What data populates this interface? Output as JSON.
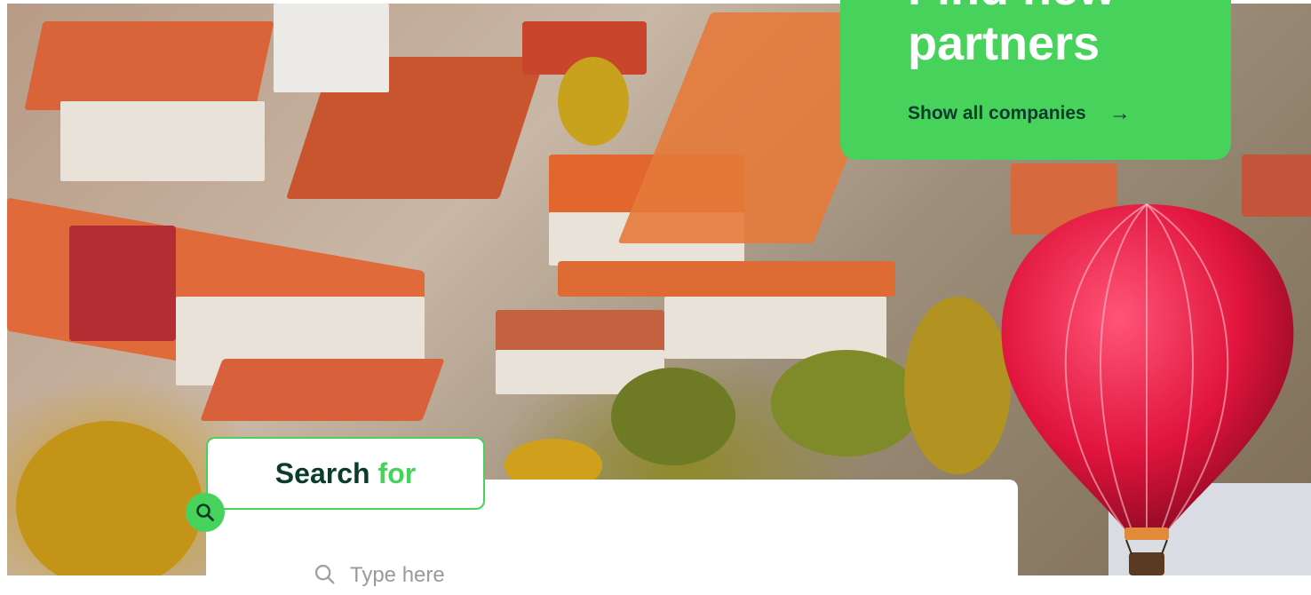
{
  "promo": {
    "title": "Find new\npartners",
    "link_label": "Show all companies",
    "link_arrow": "→"
  },
  "search": {
    "heading_main": "Search",
    "heading_accent": "for",
    "placeholder": "Type here"
  },
  "icons": {
    "badge": "search-icon",
    "input": "search-icon",
    "link": "arrow-right-icon"
  },
  "colors": {
    "brand_green": "#47d35b",
    "dark_green": "#0b3b2c"
  }
}
